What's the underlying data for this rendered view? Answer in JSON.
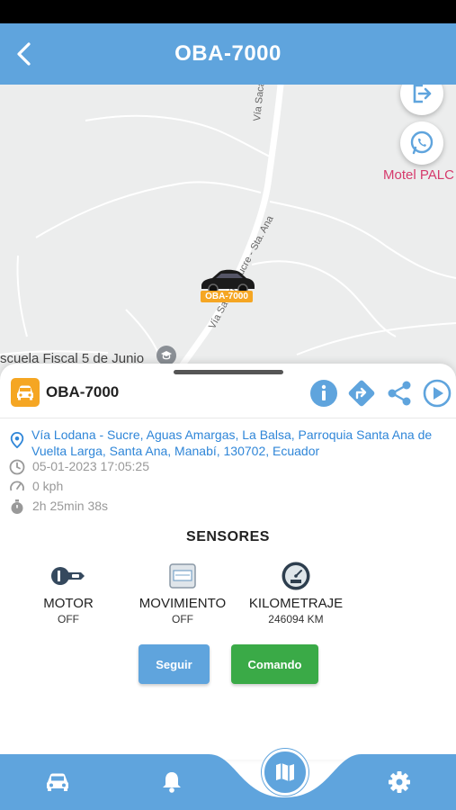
{
  "header": {
    "title": "OBA-7000"
  },
  "map": {
    "road_label_1": "Vía Sacán - Sucre - ...",
    "road_label_2": "Vía Sacán - Sucre - Sta. Ana",
    "place_school": "scuela Fiscal 5 de Junio",
    "place_motel": "Motel PALC",
    "marker_plate": "OBA-7000"
  },
  "vehicle": {
    "plate": "OBA-7000",
    "address": "Vía Lodana - Sucre, Aguas Amargas, La Balsa, Parroquia Santa Ana de Vuelta Larga, Santa Ana, Manabí, 130702, Ecuador",
    "datetime": "05-01-2023 17:05:25",
    "speed": "0 kph",
    "duration": "2h 25min 38s"
  },
  "sensors": {
    "title": "SENSORES",
    "items": [
      {
        "name": "MOTOR",
        "value": "OFF",
        "icon": "engine-key-icon"
      },
      {
        "name": "MOVIMIENTO",
        "value": "OFF",
        "icon": "movement-icon"
      },
      {
        "name": "KILOMETRAJE",
        "value": "246094 KM",
        "icon": "odometer-icon"
      }
    ]
  },
  "buttons": {
    "follow": "Seguir",
    "command": "Comando"
  },
  "colors": {
    "primary": "#5fa4dd",
    "accent": "#f5a623",
    "success": "#3aaa47",
    "link": "#2f86d8"
  }
}
